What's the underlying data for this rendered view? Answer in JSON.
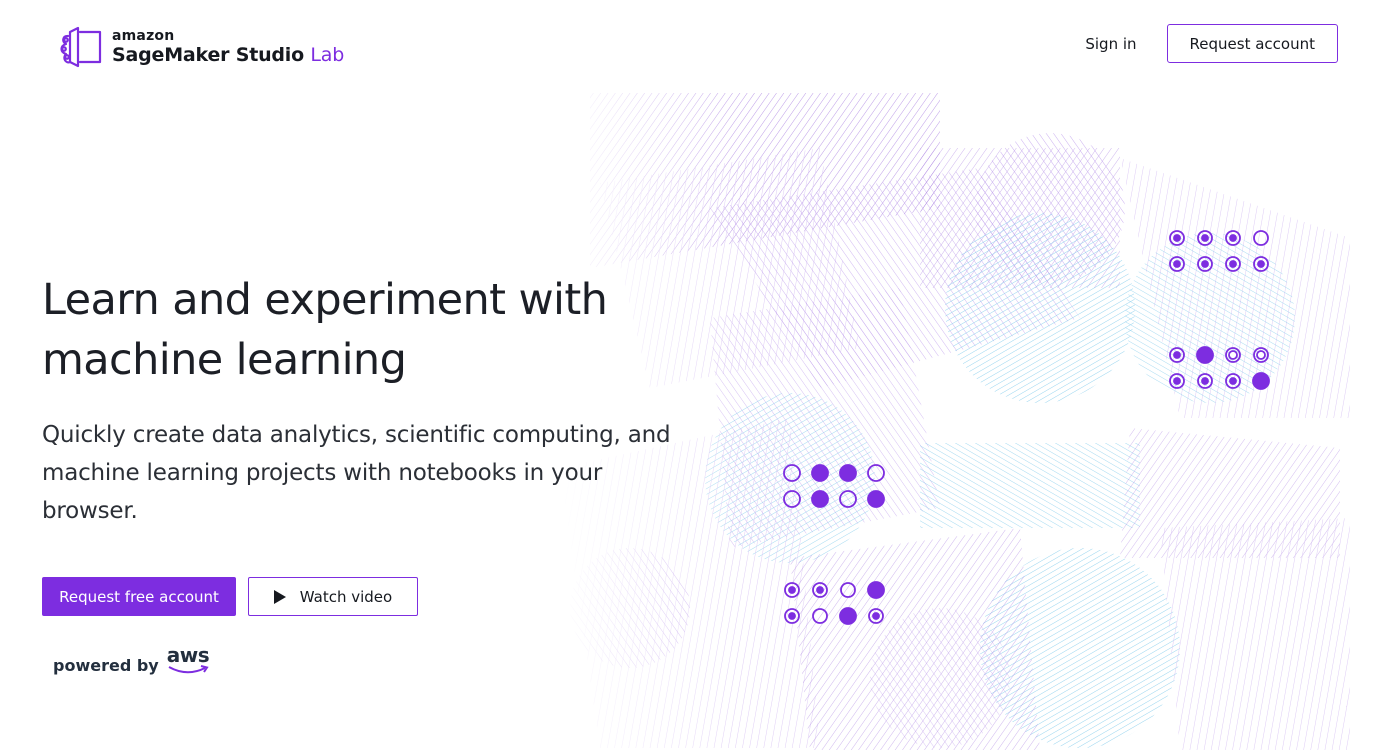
{
  "header": {
    "logo_amazon": "amazon",
    "logo_product": "SageMaker Studio",
    "logo_lab": "Lab",
    "signin_label": "Sign in",
    "request_account_label": "Request account"
  },
  "hero": {
    "title_line1": "Learn and experiment with",
    "title_line2": "machine learning",
    "subtitle": "Quickly create data analytics, scientific computing, and machine learning projects with notebooks in your browser.",
    "primary_cta": "Request free account",
    "secondary_cta": "Watch video"
  },
  "footer": {
    "powered_by": "powered by",
    "aws": "aws"
  },
  "colors": {
    "accent": "#7d2de0",
    "text": "#16191f",
    "art_purple": "#b48be6",
    "art_light_purple": "#dcc8f5",
    "art_blue": "#8fd2ee"
  },
  "icons": {
    "logo": "sagemaker-logo-icon",
    "play": "play-icon"
  }
}
